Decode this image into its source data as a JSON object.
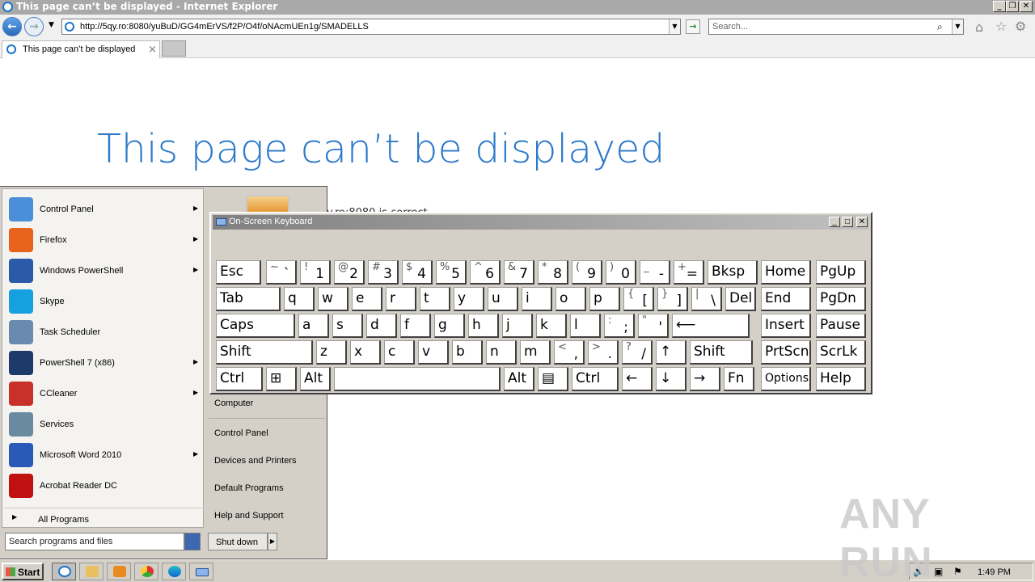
{
  "window": {
    "title": "This page can’t be displayed - Internet Explorer"
  },
  "nav": {
    "url": "http://5qy.ro:8080/yuBuD/GG4mErVS/f2P/O4f/oNAcmUEn1g/SMADELLS",
    "search_placeholder": "Search..."
  },
  "tab": {
    "label": "This page can’t be displayed",
    "close": "×"
  },
  "page": {
    "heading": "This page can’t be displayed",
    "partial_text": "y.ro:8080 is correct."
  },
  "start_menu": {
    "programs": [
      {
        "label": "Control Panel",
        "icon": "control-panel-icon",
        "has_submenu": true
      },
      {
        "label": "Firefox",
        "icon": "firefox-icon",
        "has_submenu": true
      },
      {
        "label": "Windows PowerShell",
        "icon": "powershell-icon",
        "has_submenu": true
      },
      {
        "label": "Skype",
        "icon": "skype-icon",
        "has_submenu": false
      },
      {
        "label": "Task Scheduler",
        "icon": "task-scheduler-icon",
        "has_submenu": false
      },
      {
        "label": "PowerShell 7 (x86)",
        "icon": "powershell7-icon",
        "has_submenu": true
      },
      {
        "label": "CCleaner",
        "icon": "ccleaner-icon",
        "has_submenu": true
      },
      {
        "label": "Services",
        "icon": "services-icon",
        "has_submenu": false
      },
      {
        "label": "Microsoft Word 2010",
        "icon": "word-icon",
        "has_submenu": true
      },
      {
        "label": "Acrobat Reader DC",
        "icon": "acrobat-icon",
        "has_submenu": false
      }
    ],
    "all_programs": "All Programs",
    "search_placeholder": "Search programs and files",
    "right_items": [
      "Computer",
      "Control Panel",
      "Devices and Printers",
      "Default Programs",
      "Help and Support"
    ],
    "shutdown": "Shut down"
  },
  "osk": {
    "title": "On-Screen Keyboard",
    "rows": [
      [
        {
          "m": "Esc"
        },
        {
          "s": "~",
          "b": "`"
        },
        {
          "s": "!",
          "b": "1"
        },
        {
          "s": "@",
          "b": "2"
        },
        {
          "s": "#",
          "b": "3"
        },
        {
          "s": "$",
          "b": "4"
        },
        {
          "s": "%",
          "b": "5"
        },
        {
          "s": "^",
          "b": "6"
        },
        {
          "s": "&",
          "b": "7"
        },
        {
          "s": "*",
          "b": "8"
        },
        {
          "s": "(",
          "b": "9"
        },
        {
          "s": ")",
          "b": "0"
        },
        {
          "s": "_",
          "b": "-"
        },
        {
          "s": "+",
          "b": "="
        },
        {
          "m": "Bksp"
        },
        {
          "m": "Home"
        },
        {
          "m": "PgUp"
        }
      ],
      [
        {
          "m": "Tab"
        },
        {
          "m": "q"
        },
        {
          "m": "w"
        },
        {
          "m": "e"
        },
        {
          "m": "r"
        },
        {
          "m": "t"
        },
        {
          "m": "y"
        },
        {
          "m": "u"
        },
        {
          "m": "i"
        },
        {
          "m": "o"
        },
        {
          "m": "p"
        },
        {
          "s": "{",
          "b": "["
        },
        {
          "s": "}",
          "b": "]"
        },
        {
          "s": "|",
          "b": "\\"
        },
        {
          "m": "Del"
        },
        {
          "m": "End"
        },
        {
          "m": "PgDn"
        }
      ],
      [
        {
          "m": "Caps"
        },
        {
          "m": "a"
        },
        {
          "m": "s"
        },
        {
          "m": "d"
        },
        {
          "m": "f"
        },
        {
          "m": "g"
        },
        {
          "m": "h"
        },
        {
          "m": "j"
        },
        {
          "m": "k"
        },
        {
          "m": "l"
        },
        {
          "s": ":",
          "b": ";"
        },
        {
          "s": "\"",
          "b": "'"
        },
        {
          "m": "⟵"
        },
        {
          "m": "Insert"
        },
        {
          "m": "Pause"
        }
      ],
      [
        {
          "m": "Shift"
        },
        {
          "m": "z"
        },
        {
          "m": "x"
        },
        {
          "m": "c"
        },
        {
          "m": "v"
        },
        {
          "m": "b"
        },
        {
          "m": "n"
        },
        {
          "m": "m"
        },
        {
          "s": "<",
          "b": ","
        },
        {
          "s": ">",
          "b": "."
        },
        {
          "s": "?",
          "b": "/"
        },
        {
          "m": "↑"
        },
        {
          "m": "Shift"
        },
        {
          "m": "PrtScn"
        },
        {
          "m": "ScrLk"
        }
      ],
      [
        {
          "m": "Ctrl"
        },
        {
          "m": "⊞"
        },
        {
          "m": "Alt"
        },
        {
          "m": ""
        },
        {
          "m": "Alt"
        },
        {
          "m": "▤"
        },
        {
          "m": "Ctrl"
        },
        {
          "m": "←"
        },
        {
          "m": "↓"
        },
        {
          "m": "→"
        },
        {
          "m": "Fn"
        },
        {
          "m": "Options"
        },
        {
          "m": "Help"
        }
      ]
    ]
  },
  "taskbar": {
    "start": "Start",
    "clock": "1:49 PM"
  },
  "watermark": "ANY RUN",
  "colors": {
    "heading": "#2c79c9",
    "chrome": "#d4d0c8"
  }
}
